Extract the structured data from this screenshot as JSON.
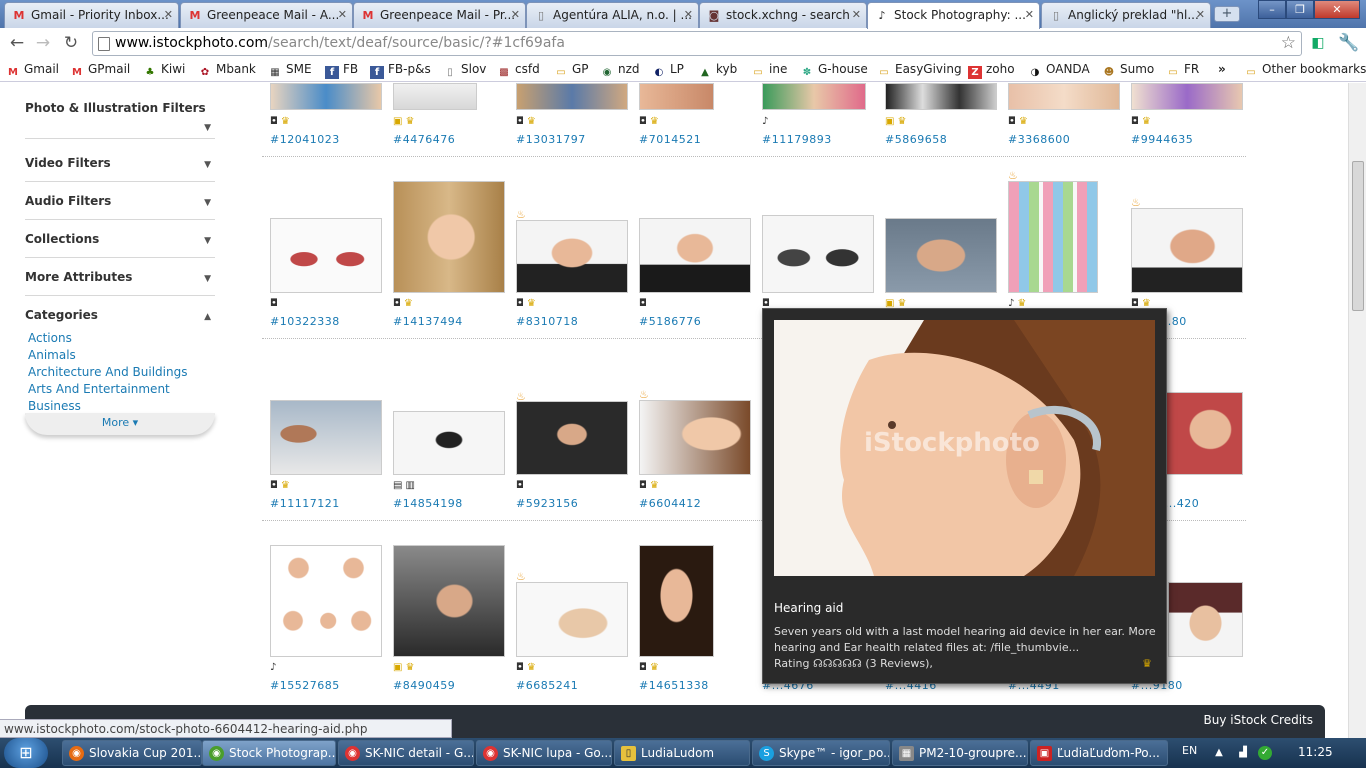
{
  "tabs": [
    {
      "title": "Gmail - Priority Inbox...",
      "icon": "M",
      "color": "#d33"
    },
    {
      "title": "Greenpeace Mail - A...",
      "icon": "M",
      "color": "#d33"
    },
    {
      "title": "Greenpeace Mail - Pr...",
      "icon": "M",
      "color": "#d33"
    },
    {
      "title": "Agentúra ALIA, n.o. | ...",
      "icon": "▯",
      "color": "#777"
    },
    {
      "title": "stock.xchng - search",
      "icon": "◙",
      "color": "#633"
    },
    {
      "title": "Stock Photography: ...",
      "icon": "♪",
      "color": "#222"
    },
    {
      "title": "Anglický preklad \"hl...",
      "icon": "▯",
      "color": "#777"
    }
  ],
  "url": {
    "host": "www.istockphoto.com",
    "path": "/search/text/deaf/source/basic/?#1cf69afa"
  },
  "bookmarks": [
    {
      "label": "Gmail",
      "icon": "M",
      "color": "#d33"
    },
    {
      "label": "GPmail",
      "icon": "M",
      "color": "#d33"
    },
    {
      "label": "Kiwi",
      "icon": "♣",
      "color": "#370"
    },
    {
      "label": "Mbank",
      "icon": "✿",
      "color": "#a12"
    },
    {
      "label": "SME",
      "icon": "▦",
      "color": "#333"
    },
    {
      "label": "FB",
      "icon": "f",
      "color": "#3b5998"
    },
    {
      "label": "FB-p&s",
      "icon": "f",
      "color": "#3b5998"
    },
    {
      "label": "Slov",
      "icon": "▯",
      "color": "#777"
    },
    {
      "label": "csfd",
      "icon": "▩",
      "color": "#922"
    },
    {
      "label": "GP",
      "icon": "▭",
      "color": "#d9a21b"
    },
    {
      "label": "nzd",
      "icon": "◉",
      "color": "#263"
    },
    {
      "label": "LP",
      "icon": "◐",
      "color": "#126"
    },
    {
      "label": "kyb",
      "icon": "▲",
      "color": "#262"
    },
    {
      "label": "ine",
      "icon": "▭",
      "color": "#d9a21b"
    },
    {
      "label": "G-house",
      "icon": "✽",
      "color": "#3a8"
    },
    {
      "label": "EasyGiving",
      "icon": "▭",
      "color": "#d9a21b"
    },
    {
      "label": "zoho",
      "icon": "Z",
      "color": "#d33"
    },
    {
      "label": "OANDA",
      "icon": "◑",
      "color": "#111"
    },
    {
      "label": "Sumo",
      "icon": "☻",
      "color": "#a72"
    },
    {
      "label": "FR",
      "icon": "▭",
      "color": "#d9a21b"
    }
  ],
  "bookmarks_more": "»",
  "other_bookmarks": "Other bookmarks",
  "sidebar": {
    "filters": [
      "Photo & Illustration Filters",
      "Video Filters",
      "Audio Filters",
      "Collections",
      "More Attributes",
      "Categories"
    ],
    "categories": [
      "Actions",
      "Animals",
      "Architecture And Buildings",
      "Arts And Entertainment",
      "Business"
    ],
    "more_label": "More ▾"
  },
  "rows": [
    [
      "#12041023",
      "#4476476",
      "#13031797",
      "#7014521",
      "#11179893",
      "#5869658",
      "#3368600",
      "#9944635"
    ],
    [
      "#10322338",
      "#14137494",
      "#8310718",
      "#5186776",
      "",
      "",
      "",
      "#...80"
    ],
    [
      "#11117121",
      "#14854198",
      "#5923156",
      "#6604412",
      "",
      "",
      "",
      "#...420"
    ],
    [
      "#15527685",
      "#8490459",
      "#6685241",
      "#14651338",
      "#...4676",
      "#...4416",
      "#...4491",
      "#...9180"
    ]
  ],
  "popup": {
    "title": "Hearing aid",
    "description": "Seven years old with a last model hearing aid device in her ear. More hearing and Ear health related files at: /file_thumbvie...",
    "rating_label": "Rating",
    "reviews": "(3 Reviews),",
    "watermark": "iStockphoto"
  },
  "statusbar": "www.istockphoto.com/stock-photo-6604412-hearing-aid.php",
  "buy_credits": "Buy iStock Credits",
  "taskbar": [
    {
      "label": "Slovakia Cup 201...",
      "icon": "◉",
      "color": "#e66b12"
    },
    {
      "label": "Stock Photograp...",
      "icon": "◉",
      "color": "#4b9e2c"
    },
    {
      "label": "SK-NIC detail - G...",
      "icon": "◉",
      "color": "#d33"
    },
    {
      "label": "SK-NIC lupa - Go...",
      "icon": "◉",
      "color": "#d33"
    },
    {
      "label": "LudiaLudom",
      "icon": "▯",
      "color": "#e6c13d"
    },
    {
      "label": "Skype™ - igor_po...",
      "icon": "S",
      "color": "#1aa0e0"
    },
    {
      "label": "PM2-10-groupre...",
      "icon": "▦",
      "color": "#888"
    },
    {
      "label": "ĽudiaĽuďom-Po...",
      "icon": "▣",
      "color": "#c22"
    }
  ],
  "tray": {
    "lang": "EN",
    "time": "11:25"
  }
}
